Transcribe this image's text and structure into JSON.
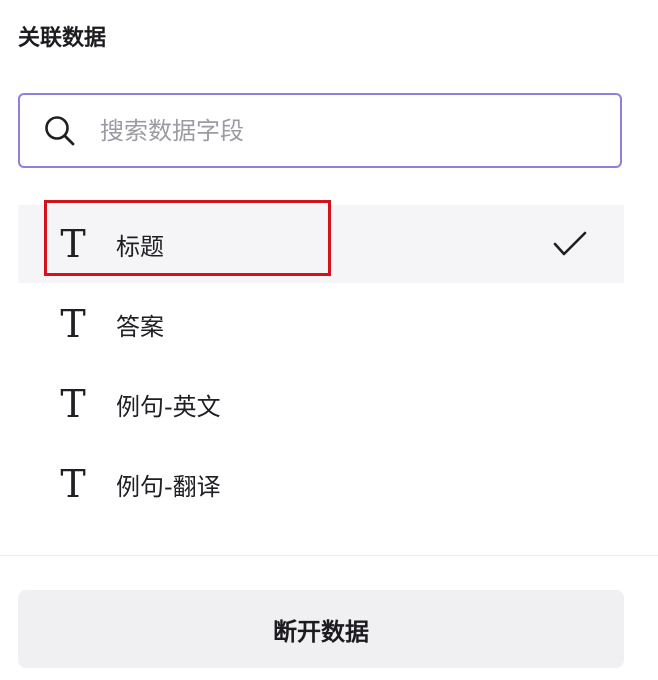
{
  "panel": {
    "title": "关联数据"
  },
  "search": {
    "placeholder": "搜索数据字段",
    "value": "",
    "icon": "search-icon"
  },
  "fields": [
    {
      "icon": "T",
      "label": "标题",
      "selected": true,
      "highlighted": true
    },
    {
      "icon": "T",
      "label": "答案",
      "selected": false,
      "highlighted": false
    },
    {
      "icon": "T",
      "label": "例句-英文",
      "selected": false,
      "highlighted": false
    },
    {
      "icon": "T",
      "label": "例句-翻译",
      "selected": false,
      "highlighted": false
    }
  ],
  "footer": {
    "disconnect_label": "断开数据"
  },
  "colors": {
    "accent_border": "#8d7fe0",
    "highlight_box": "#d3121b",
    "selected_row_bg": "#f5f5f7",
    "button_bg": "#f0f0f2"
  }
}
